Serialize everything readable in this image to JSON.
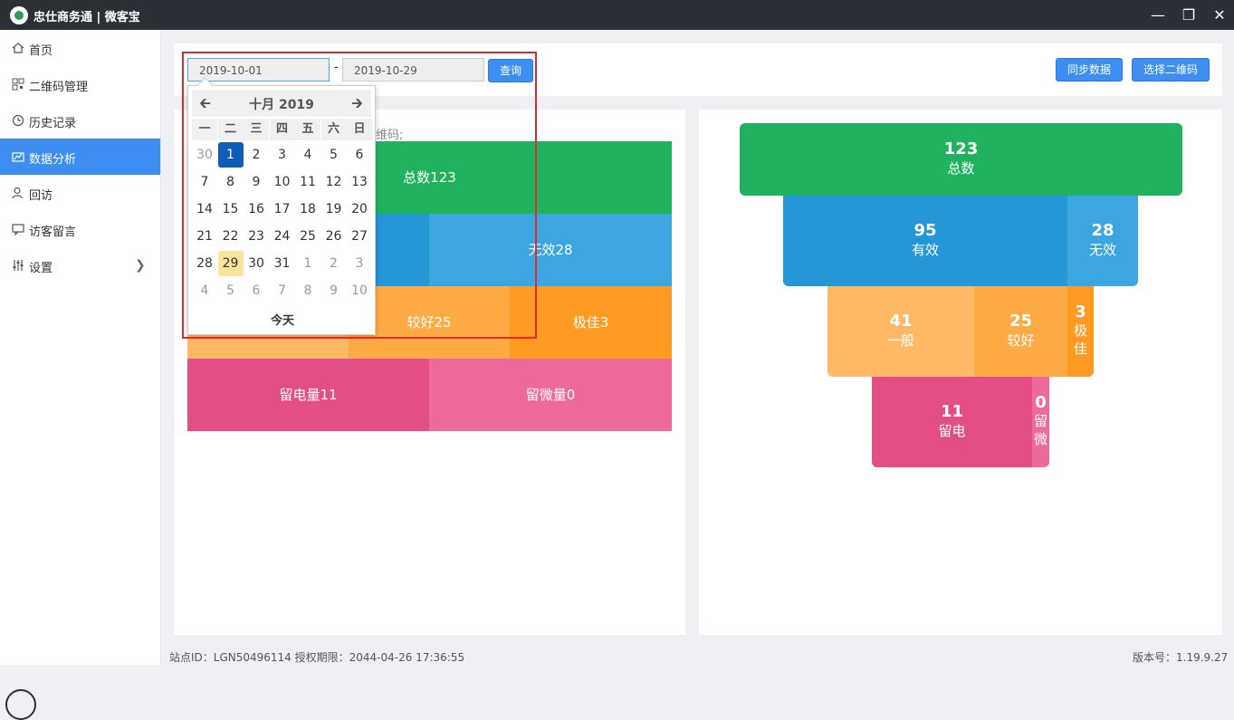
{
  "app": {
    "title": "忠仕商务通 | 微客宝"
  },
  "sidebar": {
    "items": [
      {
        "label": "首页"
      },
      {
        "label": "二维码管理"
      },
      {
        "label": "历史记录"
      },
      {
        "label": "数据分析"
      },
      {
        "label": "回访"
      },
      {
        "label": "访客留言"
      },
      {
        "label": "设置"
      }
    ]
  },
  "filters": {
    "start_date": "2019-10-01",
    "end_date": "2019-10-29",
    "separator": "-",
    "query_label": "查询",
    "sync_label": "同步数据",
    "select_qr_label": "选择二维码"
  },
  "calendar": {
    "title": "十月 2019",
    "weekdays": [
      "一",
      "二",
      "三",
      "四",
      "五",
      "六",
      "日"
    ],
    "weeks": [
      [
        "30",
        "1",
        "2",
        "3",
        "4",
        "5",
        "6"
      ],
      [
        "7",
        "8",
        "9",
        "10",
        "11",
        "12",
        "13"
      ],
      [
        "14",
        "15",
        "16",
        "17",
        "18",
        "19",
        "20"
      ],
      [
        "21",
        "22",
        "23",
        "24",
        "25",
        "26",
        "27"
      ],
      [
        "28",
        "29",
        "30",
        "31",
        "1",
        "2",
        "3"
      ],
      [
        "4",
        "5",
        "6",
        "7",
        "8",
        "9",
        "10"
      ]
    ],
    "selected_day": "1",
    "today_day": "29",
    "today_label": "今天"
  },
  "left_panel": {
    "hint": "维码;",
    "blocks": {
      "total": "总数123",
      "invalid": "无效28",
      "good": "较好25",
      "excellent": "极佳3",
      "phone": "留电量11",
      "wechat": "留微量0"
    }
  },
  "funnel": {
    "total": {
      "num": "123",
      "label": "总数"
    },
    "valid": {
      "num": "95",
      "label": "有效"
    },
    "invalid": {
      "num": "28",
      "label": "无效"
    },
    "normal": {
      "num": "41",
      "label": "一般"
    },
    "good": {
      "num": "25",
      "label": "较好"
    },
    "excellent": {
      "num": "3",
      "label": "极佳"
    },
    "phone": {
      "num": "11",
      "label": "留电"
    },
    "wechat": {
      "num": "0",
      "label": "留微"
    }
  },
  "footer": {
    "site_info": "站点ID：LGN50496114 授权期限：2044-04-26 17:36:55",
    "version": "版本号：1.19.9.27"
  },
  "colors": {
    "green": "#20b25f",
    "blue": "#2596d6",
    "light_blue": "#3ba6e0",
    "orange": "#ff9a22",
    "light_orange": "#ffab45",
    "pale_orange": "#ffb864",
    "pink": "#e34e84",
    "light_pink": "#ee6a9a",
    "accent": "#3d8ef0",
    "highlight_box": "#e22a2a"
  }
}
